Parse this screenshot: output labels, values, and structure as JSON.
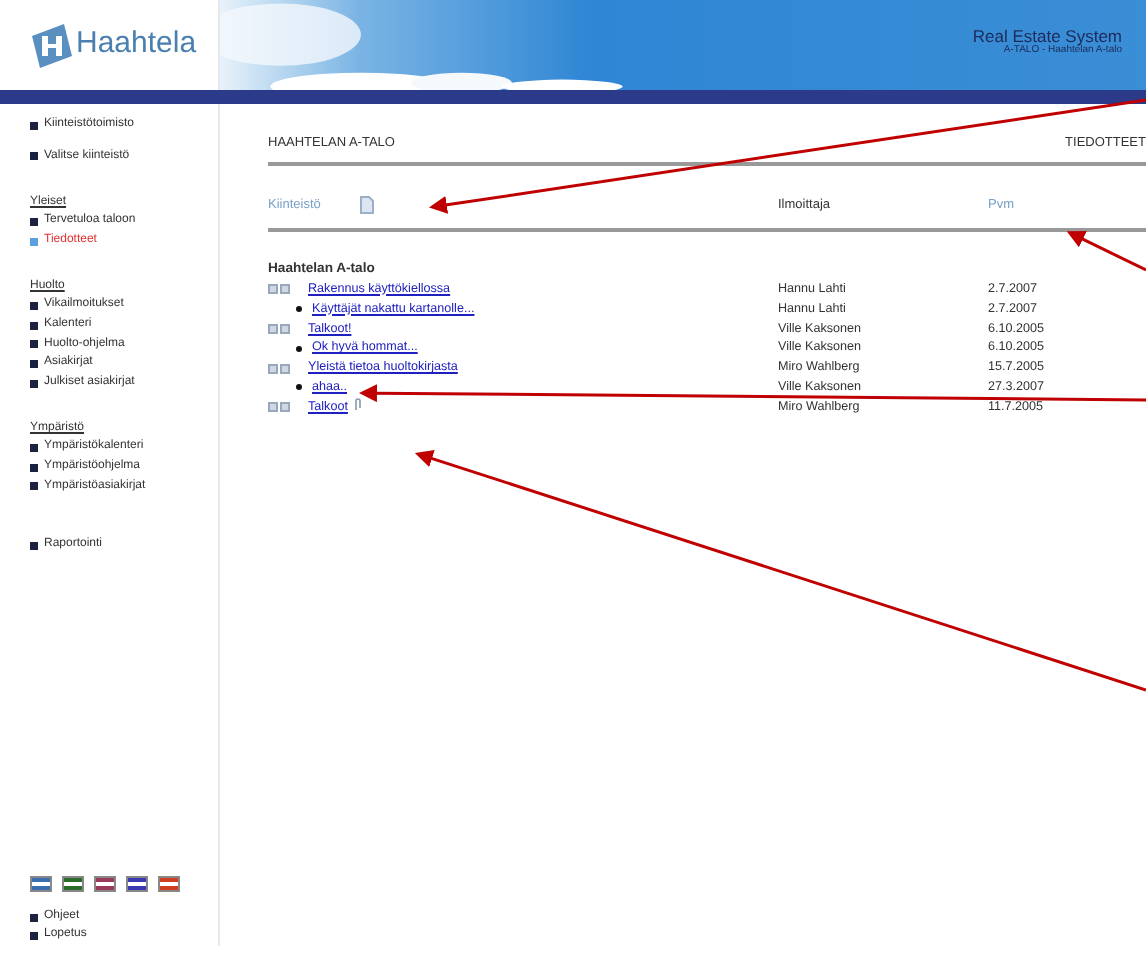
{
  "header": {
    "logo": "Haahtela",
    "title": "Real Estate System",
    "subtitle": "A-TALO - Haahtelan A-talo"
  },
  "sidebar": {
    "sections": [
      {
        "items": [
          {
            "label": "Kiinteistötoimisto",
            "selected": false
          }
        ]
      },
      {
        "items": [
          {
            "label": "Valitse kiinteistö",
            "selected": false
          }
        ]
      },
      {
        "heading": "Yleiset",
        "items": [
          {
            "label": "Tervetuloa taloon",
            "selected": false
          },
          {
            "label": "Tiedotteet",
            "selected": true
          }
        ]
      },
      {
        "heading": "Huolto",
        "items": [
          {
            "label": "Vikailmoitukset",
            "selected": false
          },
          {
            "label": "Kalenteri",
            "selected": false
          },
          {
            "label": "Huolto-ohjelma",
            "selected": false
          },
          {
            "label": "Asiakirjat",
            "selected": false
          },
          {
            "label": "Julkiset asiakirjat",
            "selected": false
          }
        ]
      },
      {
        "heading": "Ympäristö",
        "items": [
          {
            "label": "Ympäristökalenteri",
            "selected": false
          },
          {
            "label": "Ympäristöohjelma",
            "selected": false
          },
          {
            "label": "Ympäristöasiakirjat",
            "selected": false
          }
        ]
      },
      {
        "items": [
          {
            "label": "Raportointi",
            "selected": false
          }
        ]
      }
    ],
    "flags": [
      {
        "color": "#3a6fb0"
      },
      {
        "color": "#2a6b2a"
      },
      {
        "color": "#9a3a5a"
      },
      {
        "color": "#3a3ab0"
      },
      {
        "color": "#d04020"
      }
    ],
    "footer_items": [
      {
        "label": "Ohjeet"
      },
      {
        "label": "Lopetus"
      }
    ]
  },
  "page": {
    "breadcrumb": "HAAHTELAN A-TALO",
    "section": "TIEDOTTEET",
    "columns": [
      "Kiinteistö",
      "Ilmoittaja",
      "Pvm"
    ],
    "group": "Haahtelan A-talo",
    "rows": [
      {
        "kind": "topic",
        "title": "Rakennus käyttökiellossa",
        "author": "Hannu Lahti",
        "date": "2.7.2007",
        "attachment": false
      },
      {
        "kind": "reply",
        "title": "Käyttäjät nakattu kartanolle...",
        "author": "Hannu Lahti",
        "date": "2.7.2007",
        "attachment": false
      },
      {
        "kind": "topic",
        "title": "Talkoot!",
        "author": "Ville Kaksonen",
        "date": "6.10.2005",
        "attachment": false
      },
      {
        "kind": "reply",
        "title": "Ok hyvä hommat...",
        "author": "Ville Kaksonen",
        "date": "6.10.2005",
        "attachment": false
      },
      {
        "kind": "topic",
        "title": "Yleistä tietoa huoltokirjasta",
        "author": "Miro Wahlberg",
        "date": "15.7.2005",
        "attachment": false
      },
      {
        "kind": "reply",
        "title": "ahaa..",
        "author": "Ville Kaksonen",
        "date": "27.3.2007",
        "attachment": false
      },
      {
        "kind": "topic",
        "title": "Talkoot",
        "author": "Miro Wahlberg",
        "date": "11.7.2005",
        "attachment": true
      }
    ]
  },
  "annotations": [
    {
      "kind": "arrow"
    },
    {
      "kind": "arrow"
    },
    {
      "kind": "arrow"
    },
    {
      "kind": "arrow"
    }
  ]
}
